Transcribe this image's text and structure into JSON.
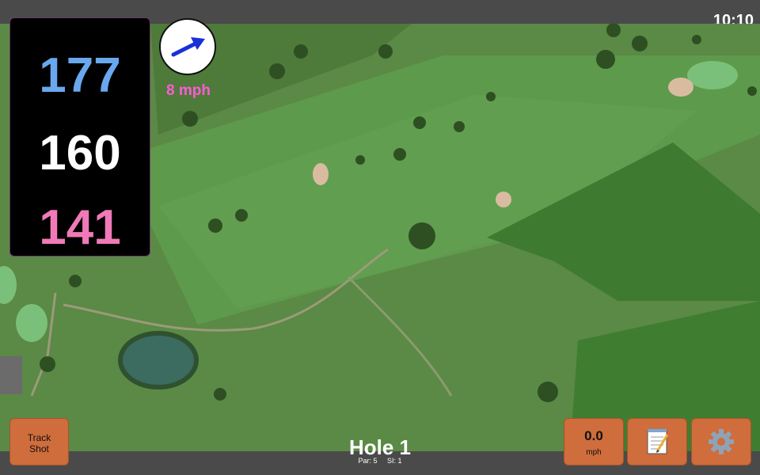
{
  "status": {
    "time": "10:10"
  },
  "distances": {
    "back": "177",
    "middle": "160",
    "front": "141"
  },
  "wind": {
    "speed_label": "8 mph",
    "arrow_icon": "wind-direction-arrow-icon"
  },
  "hole": {
    "title": "Hole 1",
    "par": "Par: 5",
    "si": "SI: 1"
  },
  "buttons": {
    "track_shot_line1": "Track",
    "track_shot_line2": "Shot",
    "wind_value": "0.0",
    "wind_unit": "mph",
    "notes_icon": "notepad-icon",
    "settings_icon": "gear-icon"
  },
  "colors": {
    "back": "#69a8ee",
    "middle": "#ffffff",
    "front": "#f07ab8",
    "wind_text": "#ff5bd6",
    "button": "#cf6d3c"
  }
}
